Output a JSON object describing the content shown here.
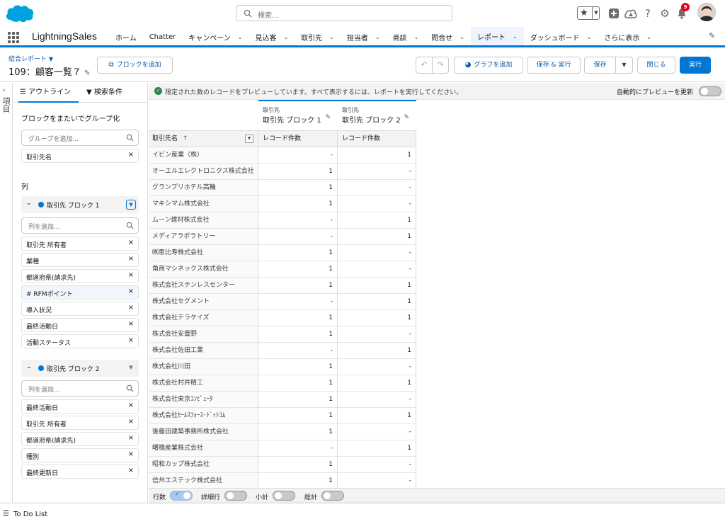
{
  "colors": {
    "brand": "#0176d3",
    "link": "#0b5cab",
    "success": "#2e844a",
    "badge": "#ea001e"
  },
  "header": {
    "search_placeholder": "検索...",
    "notification_count": "9"
  },
  "nav": {
    "app_name": "LightningSales",
    "items": [
      {
        "label": "ホーム",
        "chevron": false
      },
      {
        "label": "Chatter",
        "chevron": false
      },
      {
        "label": "キャンペーン",
        "chevron": true
      },
      {
        "label": "見込客",
        "chevron": true
      },
      {
        "label": "取引先",
        "chevron": true
      },
      {
        "label": "担当者",
        "chevron": true
      },
      {
        "label": "商談",
        "chevron": true
      },
      {
        "label": "問合せ",
        "chevron": true
      },
      {
        "label": "レポート",
        "chevron": true,
        "active": true
      },
      {
        "label": "ダッシュボード",
        "chevron": true
      },
      {
        "label": "さらに表示",
        "chevron": true
      }
    ]
  },
  "report": {
    "type_label": "結合レポート",
    "title": "109：顧客一覧７",
    "add_block": "ブロックを追加",
    "add_chart": "グラフを追加",
    "save_and_run": "保存 & 実行",
    "save": "保存",
    "close": "閉じる",
    "run": "実行"
  },
  "side_tab": {
    "label": "項目"
  },
  "outline": {
    "tab_outline": "アウトライン",
    "tab_filters": "検索条件",
    "group_title": "ブロックをまたいでグループ化",
    "group_placeholder": "グループを追加...",
    "groups": [
      "取引先名"
    ],
    "columns_title": "列",
    "block1": {
      "name": "取引先 ブロック 1",
      "placeholder": "列を追加...",
      "columns": [
        "取引先 所有者",
        "業種",
        "都道府県(請求先)",
        "# RFMポイント",
        "導入状況",
        "最終活動日",
        "活動ステータス"
      ]
    },
    "block2": {
      "name": "取引先 ブロック 2",
      "placeholder": "列を追加...",
      "columns": [
        "最終活動日",
        "取引先 所有者",
        "都道府県(請求先)",
        "種別",
        "最終更新日"
      ]
    }
  },
  "preview": {
    "message": "限定された数のレコードをプレビューしています。すべて表示するには、レポートを実行してください。",
    "auto_update": "自動的にプレビューを更新"
  },
  "grid": {
    "block1_super": "取引先",
    "block1_title": "取引先 ブロック 1",
    "block2_super": "取引先",
    "block2_title": "取引先 ブロック 2",
    "name_header": "取引先名",
    "sort_arrow": "↑",
    "count_header": "レコード件数",
    "rows": [
      [
        "イビン産業（株）",
        "-",
        "1"
      ],
      [
        "オーエルエレクトロニクス株式会社",
        "1",
        "-"
      ],
      [
        "グランプリホテル高輪",
        "1",
        "-"
      ],
      [
        "マキシマム株式会社",
        "1",
        "-"
      ],
      [
        "ムーン建材株式会社",
        "-",
        "1"
      ],
      [
        "メディアラボラトリー",
        "-",
        "1"
      ],
      [
        "㈱恵比寿株式会社",
        "1",
        "-"
      ],
      [
        "角商マシネックス株式会社",
        "1",
        "-"
      ],
      [
        "株式会社ステンレスセンター",
        "1",
        "1"
      ],
      [
        "株式会社セグメント",
        "-",
        "1"
      ],
      [
        "株式会社テラケイズ",
        "1",
        "1"
      ],
      [
        "株式会社安曇野",
        "1",
        "-"
      ],
      [
        "株式会社佐田工業",
        "-",
        "1"
      ],
      [
        "株式会社川田",
        "1",
        "-"
      ],
      [
        "株式会社村井精工",
        "1",
        "1"
      ],
      [
        "株式会社東京ｺﾝﾋﾟｭｰﾀ",
        "1",
        "-"
      ],
      [
        "株式会社ｾｰﾙｽﾌｫｰｽ･ﾄﾞｯﾄｺﾑ",
        "1",
        "1"
      ],
      [
        "後藤田建築事務所株式会社",
        "1",
        "-"
      ],
      [
        "曙橋産業株式会社",
        "-",
        "1"
      ],
      [
        "昭和カップ株式会社",
        "1",
        "-"
      ],
      [
        "信州エステック株式会社",
        "1",
        "-"
      ]
    ]
  },
  "footer": {
    "rows_label": "行数",
    "detail_rows_label": "詳細行",
    "subtotal_label": "小計",
    "grand_total_label": "総計",
    "rows_on": true,
    "detail_rows_on": false,
    "subtotal_on": false,
    "grand_total_on": false
  },
  "utility": {
    "todo_label": "To Do List"
  }
}
